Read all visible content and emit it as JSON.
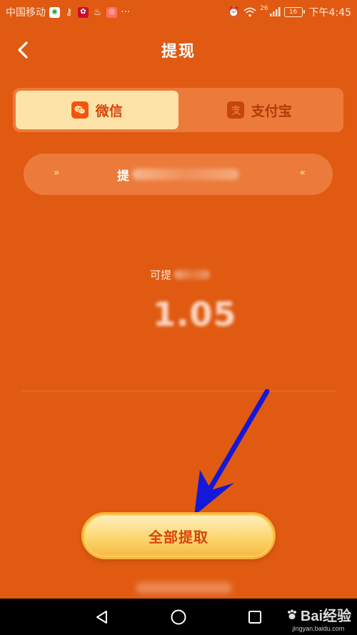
{
  "status_bar": {
    "carrier": "中国移动",
    "more": "···",
    "network": "26",
    "battery": "16",
    "time": "下午4:45"
  },
  "header": {
    "title": "提现"
  },
  "tabs": [
    {
      "label": "微信",
      "icon": "wechat-icon",
      "active": true
    },
    {
      "label": "支付宝",
      "icon": "alipay-icon",
      "active": false
    }
  ],
  "account": {
    "prefix": "提",
    "left_chevron": "»",
    "right_chevron": "«"
  },
  "balance": {
    "label_prefix": "可提",
    "value": "1.05"
  },
  "actions": {
    "withdraw_all": "全部提取"
  },
  "watermark": {
    "brand": "Bai经验",
    "url": "jingyan.baidu.com"
  },
  "colors": {
    "background": "#e05a12",
    "button_text": "#d8440a",
    "arrow": "#1418d8"
  }
}
